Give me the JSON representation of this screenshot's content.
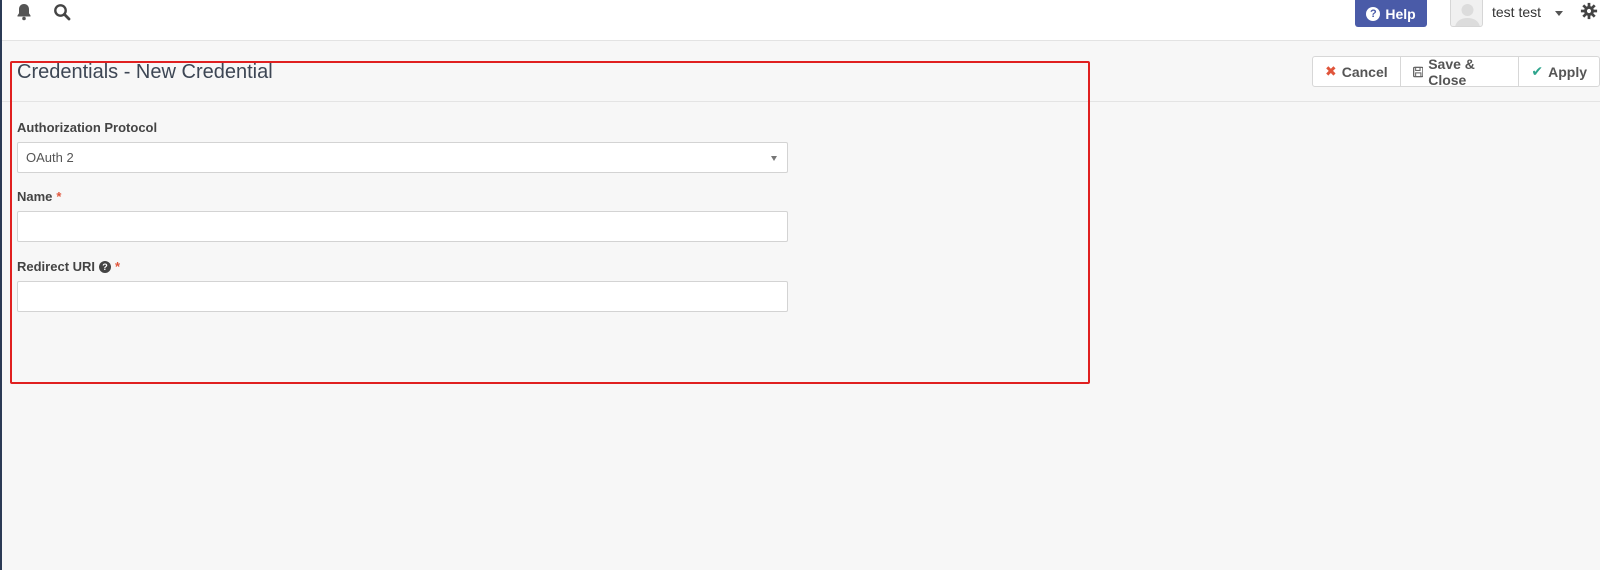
{
  "topbar": {
    "help_label": "Help",
    "user_name": "test test",
    "icons": [
      "bell-icon",
      "search-icon",
      "user-avatar",
      "gear-icon"
    ]
  },
  "header": {
    "title": "Credentials - New Credential",
    "actions": {
      "cancel": "Cancel",
      "save_close": "Save & Close",
      "apply": "Apply"
    }
  },
  "form": {
    "auth_protocol": {
      "label": "Authorization Protocol",
      "value": "OAuth 2"
    },
    "name": {
      "label": "Name",
      "required": "*",
      "value": ""
    },
    "redirect_uri": {
      "label": "Redirect URI",
      "required": "*",
      "value": ""
    }
  },
  "colors": {
    "help_button": "#4a5ba8",
    "required": "#e0553b",
    "apply_check": "#2ea58d",
    "highlight": "#e02020"
  }
}
